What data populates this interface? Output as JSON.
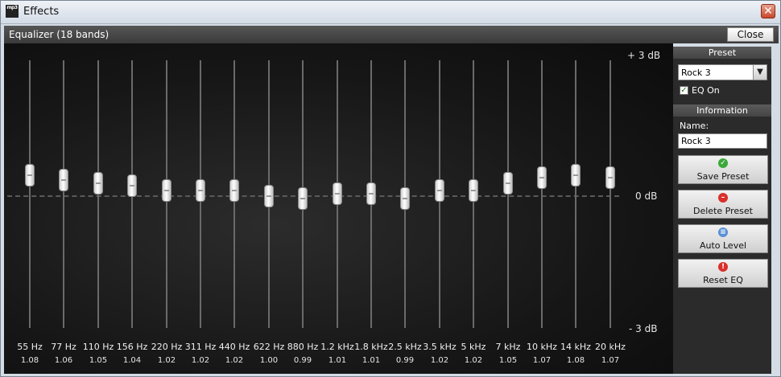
{
  "window": {
    "title": "Effects",
    "app_icon_text": "mp3"
  },
  "panel": {
    "title": "Equalizer (18 bands)",
    "close_label": "Close"
  },
  "db_scale": {
    "top": "+ 3 dB",
    "mid": "0 dB",
    "bottom": "- 3 dB"
  },
  "bands": [
    {
      "label": "55 Hz",
      "value": "1.08",
      "level": 1.08
    },
    {
      "label": "77 Hz",
      "value": "1.06",
      "level": 1.06
    },
    {
      "label": "110 Hz",
      "value": "1.05",
      "level": 1.05
    },
    {
      "label": "156 Hz",
      "value": "1.04",
      "level": 1.04
    },
    {
      "label": "220 Hz",
      "value": "1.02",
      "level": 1.02
    },
    {
      "label": "311 Hz",
      "value": "1.02",
      "level": 1.02
    },
    {
      "label": "440 Hz",
      "value": "1.02",
      "level": 1.02
    },
    {
      "label": "622 Hz",
      "value": "1.00",
      "level": 1.0
    },
    {
      "label": "880 Hz",
      "value": "0.99",
      "level": 0.99
    },
    {
      "label": "1.2 kHz",
      "value": "1.01",
      "level": 1.01
    },
    {
      "label": "1.8 kHz",
      "value": "1.01",
      "level": 1.01
    },
    {
      "label": "2.5 kHz",
      "value": "0.99",
      "level": 0.99
    },
    {
      "label": "3.5 kHz",
      "value": "1.02",
      "level": 1.02
    },
    {
      "label": "5 kHz",
      "value": "1.02",
      "level": 1.02
    },
    {
      "label": "7 kHz",
      "value": "1.05",
      "level": 1.05
    },
    {
      "label": "10 kHz",
      "value": "1.07",
      "level": 1.07
    },
    {
      "label": "14 kHz",
      "value": "1.08",
      "level": 1.08
    },
    {
      "label": "20 kHz",
      "value": "1.07",
      "level": 1.07
    }
  ],
  "preset": {
    "header": "Preset",
    "selected": "Rock 3",
    "eq_on_label": "EQ On",
    "eq_on": true
  },
  "information": {
    "header": "Information",
    "name_label": "Name:",
    "name_value": "Rock 3"
  },
  "actions": [
    {
      "label": "Save Preset",
      "icon": "check-icon",
      "color": "#3aa83a"
    },
    {
      "label": "Delete Preset",
      "icon": "minus-circle-icon",
      "color": "#d9302a"
    },
    {
      "label": "Auto Level",
      "icon": "level-icon",
      "color": "#5a8fd6"
    },
    {
      "label": "Reset EQ",
      "icon": "exclamation-icon",
      "color": "#d9302a"
    }
  ]
}
